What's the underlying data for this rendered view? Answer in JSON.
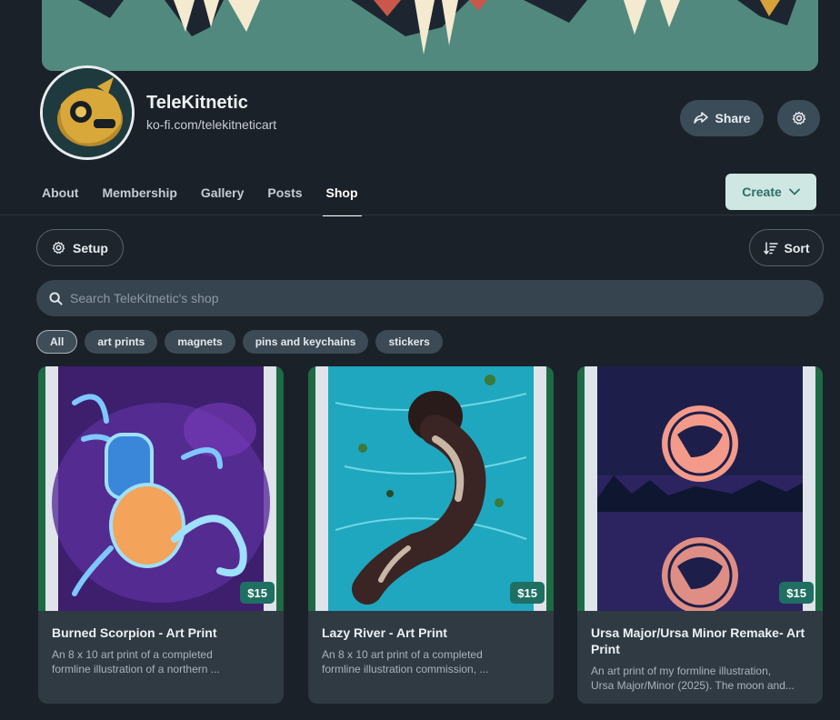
{
  "profile": {
    "name": "TeleKitnetic",
    "url": "ko-fi.com/telekitneticart"
  },
  "actions": {
    "share_label": "Share",
    "create_label": "Create",
    "setup_label": "Setup",
    "sort_label": "Sort"
  },
  "tabs": [
    {
      "label": "About"
    },
    {
      "label": "Membership"
    },
    {
      "label": "Gallery"
    },
    {
      "label": "Posts"
    },
    {
      "label": "Shop",
      "active": true
    }
  ],
  "search": {
    "placeholder": "Search TeleKitnetic's shop",
    "value": ""
  },
  "filters": [
    {
      "label": "All",
      "active": true
    },
    {
      "label": "art prints"
    },
    {
      "label": "magnets"
    },
    {
      "label": "pins and keychains"
    },
    {
      "label": "stickers"
    }
  ],
  "products": [
    {
      "title": "Burned Scorpion - Art Print",
      "price": "$15",
      "description_lines": [
        "An 8 x 10 art print of a completed",
        "formline illustration of a northern ..."
      ]
    },
    {
      "title": "Lazy River - Art Print",
      "price": "$15",
      "description_lines": [
        "An 8 x 10 art print of a completed",
        "formline illustration commission, ..."
      ]
    },
    {
      "title": "Ursa Major/Ursa Minor Remake- Art Print",
      "price": "$15",
      "description_lines": [
        "An art print of my formline illustration,",
        "Ursa Major/Minor (2025). The moon and..."
      ]
    }
  ],
  "colors": {
    "background": "#1b2128",
    "accent": "#1f6f63",
    "create_button": "#cfe7e2"
  }
}
